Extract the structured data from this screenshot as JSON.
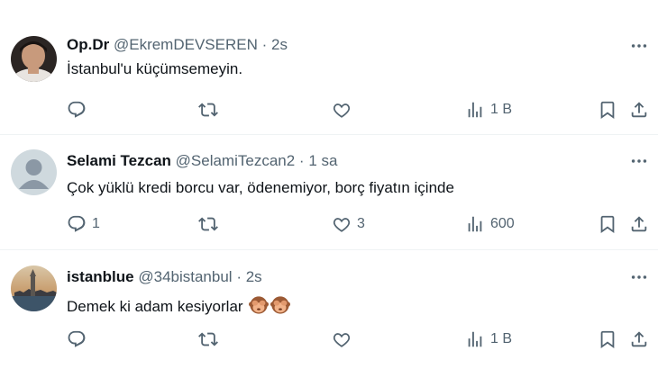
{
  "tweets": [
    {
      "name": "Op.Dr",
      "handle": "@EkremDEVSEREN",
      "dot": "·",
      "time": "2s",
      "text": "İstanbul'u küçümsemeyin.",
      "replies": "",
      "retweets": "",
      "likes": "",
      "views": "1 B"
    },
    {
      "name": "Selami Tezcan",
      "handle": "@SelamiTezcan2",
      "dot": "·",
      "time": "1 sa",
      "text": "Çok yüklü kredi borcu var, ödenemiyor, borç fiyatın içinde",
      "replies": "1",
      "retweets": "",
      "likes": "3",
      "views": "600"
    },
    {
      "name": "istanblue",
      "handle": "@34bistanbul",
      "dot": "·",
      "time": "2s",
      "text": "Demek ki adam kesiyorlar",
      "replies": "",
      "retweets": "",
      "likes": "",
      "views": "1 B"
    }
  ],
  "icons": {
    "reply": "reply-icon",
    "retweet": "retweet-icon",
    "like": "heart-icon",
    "views": "views-icon",
    "bookmark": "bookmark-icon",
    "share": "share-icon",
    "more": "more-dots-icon",
    "emoji": "see-no-evil-monkey-emoji"
  },
  "colors": {
    "text": "#0f1419",
    "secondary": "#536471",
    "divider": "#eff3f4"
  }
}
